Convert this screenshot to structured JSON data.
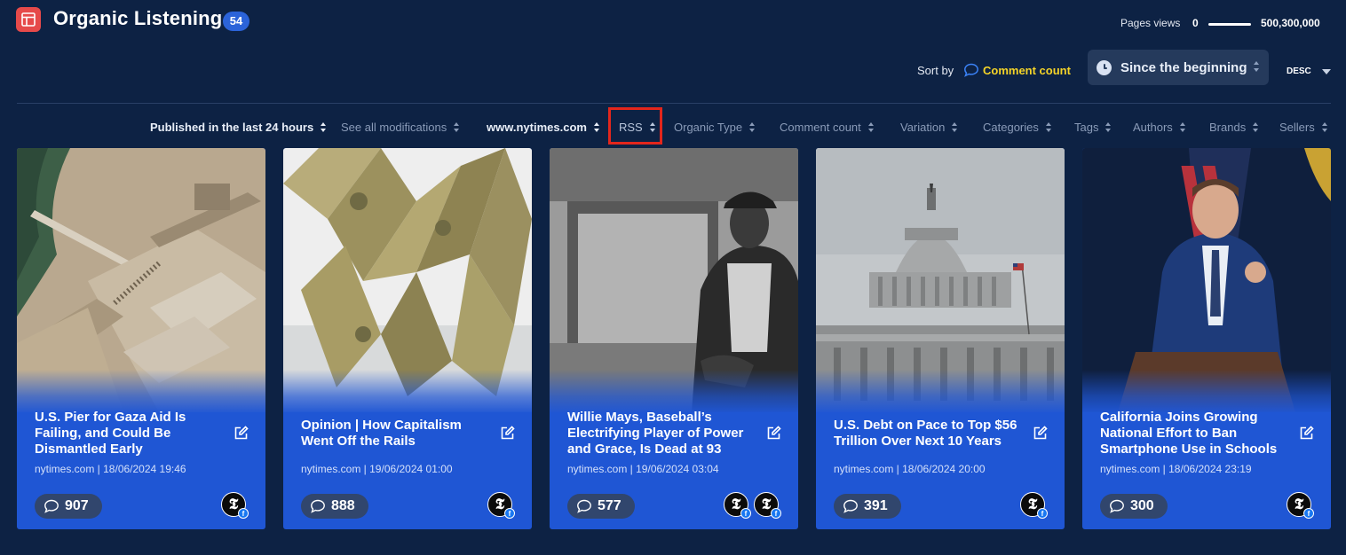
{
  "header": {
    "title": "Organic Listening",
    "count": "54",
    "pageviews": {
      "label": "Pages views",
      "min": "0",
      "max": "500,300,000",
      "range_fraction": [
        0,
        1
      ]
    }
  },
  "sort": {
    "label": "Sort by",
    "value": "Comment count",
    "period": "Since the beginning",
    "order": "DESC"
  },
  "filters": [
    {
      "label": "Published in the last 24 hours",
      "active": true
    },
    {
      "label": "See all modifications",
      "active": false
    },
    {
      "label": "www.nytimes.com",
      "active": true
    },
    {
      "label": "RSS",
      "active": false,
      "highlighted": true
    },
    {
      "label": "Organic Type",
      "active": false
    },
    {
      "label": "Comment count",
      "active": false
    },
    {
      "label": "Variation",
      "active": false
    },
    {
      "label": "Categories",
      "active": false
    },
    {
      "label": "Tags",
      "active": false
    },
    {
      "label": "Authors",
      "active": false
    },
    {
      "label": "Brands",
      "active": false
    },
    {
      "label": "Sellers",
      "active": false
    }
  ],
  "cards": [
    {
      "title": "U.S. Pier for Gaza Aid Is Failing, and Could Be Dismantled Early",
      "meta": "nytimes.com | 18/06/2024 19:46",
      "comments": "907",
      "sources": 1,
      "image": "aerial-pier-photo"
    },
    {
      "title": "Opinion | How Capitalism Went Off the Rails",
      "meta": "nytimes.com | 19/06/2024 01:00",
      "comments": "888",
      "sources": 1,
      "image": "dollar-card-house-photo"
    },
    {
      "title": "Willie Mays, Baseball’s Electrifying Player of Power and Grace, Is Dead at 93",
      "meta": "nytimes.com | 19/06/2024 03:04",
      "comments": "577",
      "sources": 2,
      "image": "baseball-player-photo"
    },
    {
      "title": "U.S. Debt on Pace to Top $56 Trillion Over Next 10 Years",
      "meta": "nytimes.com | 18/06/2024 20:00",
      "comments": "391",
      "sources": 1,
      "image": "capitol-dome-photo"
    },
    {
      "title": "California Joins Growing National Effort to Ban Smartphone Use in Schools",
      "meta": "nytimes.com | 18/06/2024 23:19",
      "comments": "300",
      "sources": 1,
      "image": "speaker-podium-photo"
    }
  ],
  "source_logo": {
    "glyph": "𝕿",
    "badge": "f"
  },
  "colors": {
    "background": "#0d2244",
    "card": "#1f56d4",
    "accent_yellow": "#f5d428",
    "badge_blue": "#2b63d9",
    "highlight_red": "#e3261c",
    "app_icon": "#e64a4a"
  }
}
